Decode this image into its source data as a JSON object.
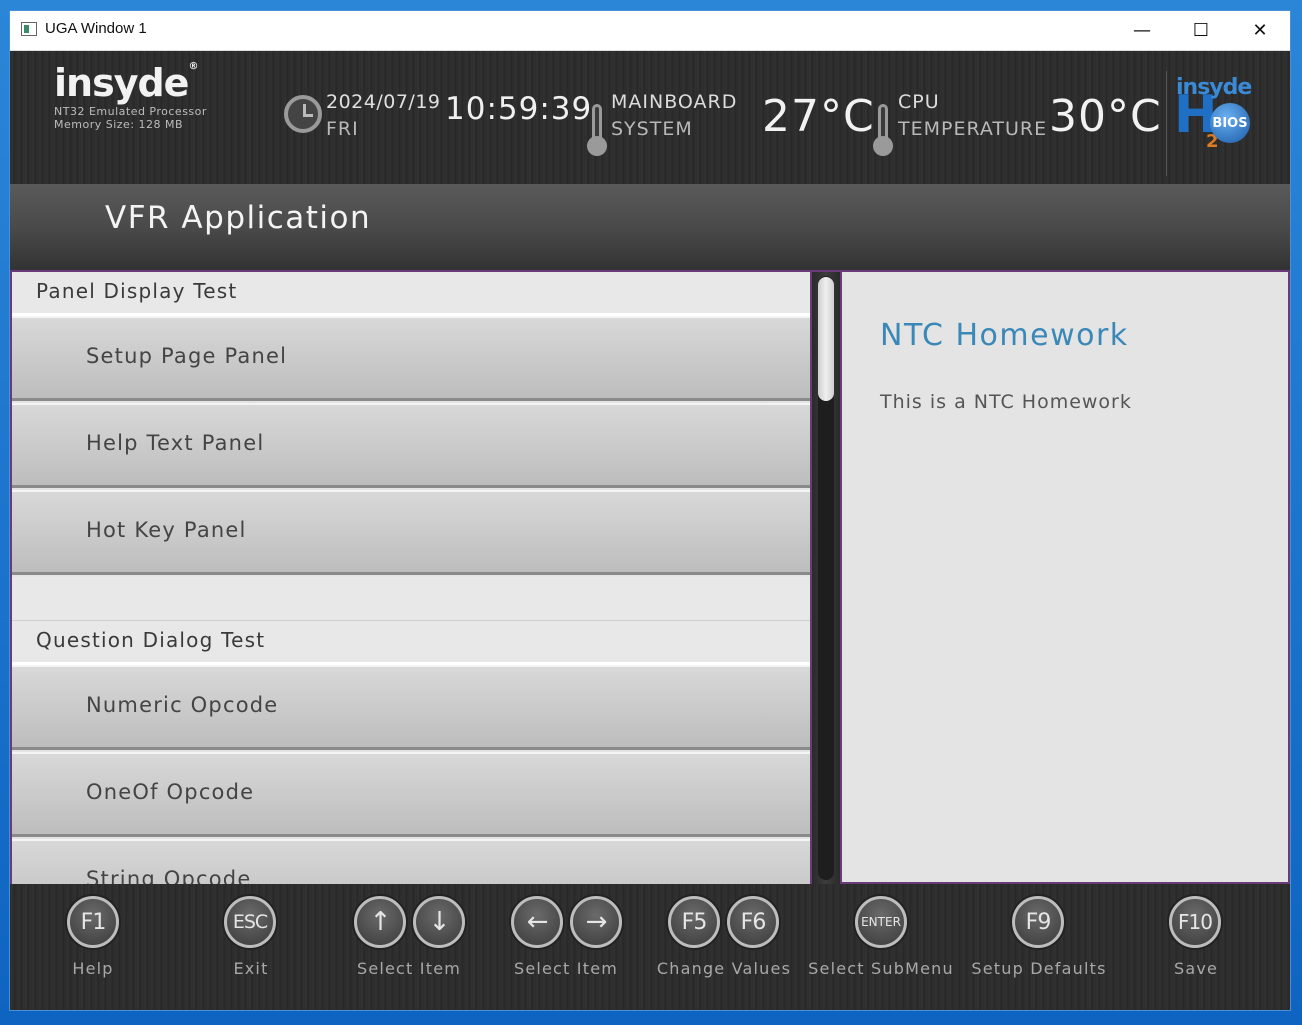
{
  "window": {
    "title": "UGA Window 1"
  },
  "header": {
    "brand": "insyde",
    "processor": "NT32 Emulated Processor",
    "memory": "Memory Size: 128 MB",
    "date": "2024/07/19",
    "day": "FRI",
    "time": "10:59:39",
    "mainboard": {
      "line1": "MAINBOARD",
      "line2": "SYSTEM",
      "temp": "27°C"
    },
    "cpu": {
      "line1": "CPU",
      "line2": "TEMPERATURE",
      "temp": "30°C"
    },
    "h2_logo": {
      "top": "insyde",
      "letter": "H",
      "sub": "2",
      "badge": "BIOS"
    }
  },
  "page": {
    "title": "VFR Application"
  },
  "menu": {
    "sections": [
      {
        "label": "Panel Display Test"
      },
      {
        "label": "Question Dialog Test"
      }
    ],
    "items": [
      {
        "label": "Setup Page Panel"
      },
      {
        "label": "Help Text Panel"
      },
      {
        "label": "Hot Key Panel"
      },
      {
        "label": "Numeric Opcode"
      },
      {
        "label": "OneOf Opcode"
      },
      {
        "label": "String Opcode"
      }
    ]
  },
  "help": {
    "title": "NTC Homework",
    "text": "This is a NTC Homework"
  },
  "footer": {
    "keys": [
      {
        "key": "F1",
        "label": "Help"
      },
      {
        "key": "ESC",
        "label": "Exit"
      },
      {
        "key_a": "↑",
        "key_b": "↓",
        "label": "Select Item"
      },
      {
        "key_a": "←",
        "key_b": "→",
        "label": "Select Item"
      },
      {
        "key_a": "F5",
        "key_b": "F6",
        "label": "Change Values"
      },
      {
        "key": "ENTER",
        "label": "Select  SubMenu"
      },
      {
        "key": "F9",
        "label": "Setup Defaults"
      },
      {
        "key": "F10",
        "label": "Save"
      }
    ]
  }
}
